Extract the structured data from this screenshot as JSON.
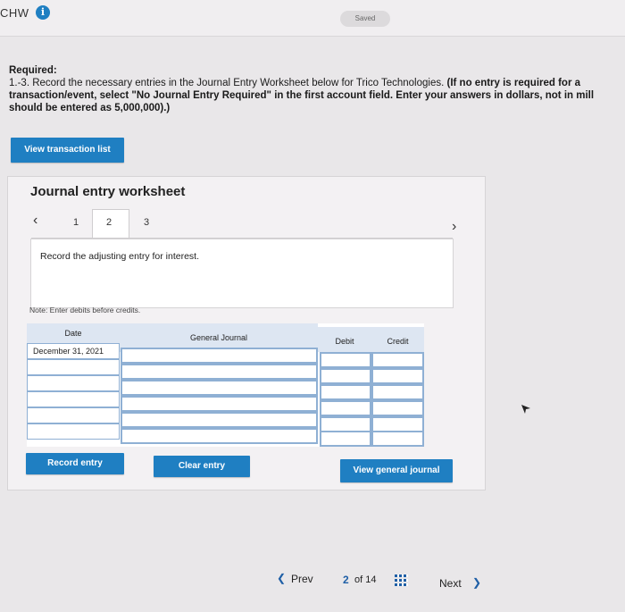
{
  "header": {
    "brand": "CHW",
    "info_icon": "info-icon",
    "saved_label": "Saved"
  },
  "instructions": {
    "label": "Required:",
    "line1_prefix": "1.-3. Record the necessary entries in the Journal Entry Worksheet below for Trico Technologies. ",
    "line1_bold": "(If no entry is required for a",
    "line2": "transaction/event, select \"No Journal Entry Required\" in the first account field. Enter your answers in dollars, not in mill",
    "line3": "should be entered as 5,000,000).)"
  },
  "view_transaction_button": "View transaction list",
  "worksheet": {
    "title": "Journal entry worksheet",
    "tabs": [
      "1",
      "2",
      "3"
    ],
    "active_tab": "2",
    "description": "Record the adjusting entry for interest.",
    "note": "Note: Enter debits before credits.",
    "columns": {
      "date": "Date",
      "account": "General Journal",
      "debit": "Debit",
      "credit": "Credit"
    },
    "rows": [
      {
        "date": "December 31, 2021"
      },
      {
        "date": ""
      },
      {
        "date": ""
      },
      {
        "date": ""
      },
      {
        "date": ""
      },
      {
        "date": ""
      }
    ]
  },
  "buttons": {
    "record": "Record entry",
    "clear": "Clear entry",
    "view_journal": "View general journal"
  },
  "pagination": {
    "prev": "Prev",
    "current": "2",
    "of_label": "of 14",
    "next": "Next"
  },
  "colors": {
    "accent": "#1f7fc2",
    "grid_header": "#dde6f2",
    "grid_border": "#8fb0d4"
  }
}
